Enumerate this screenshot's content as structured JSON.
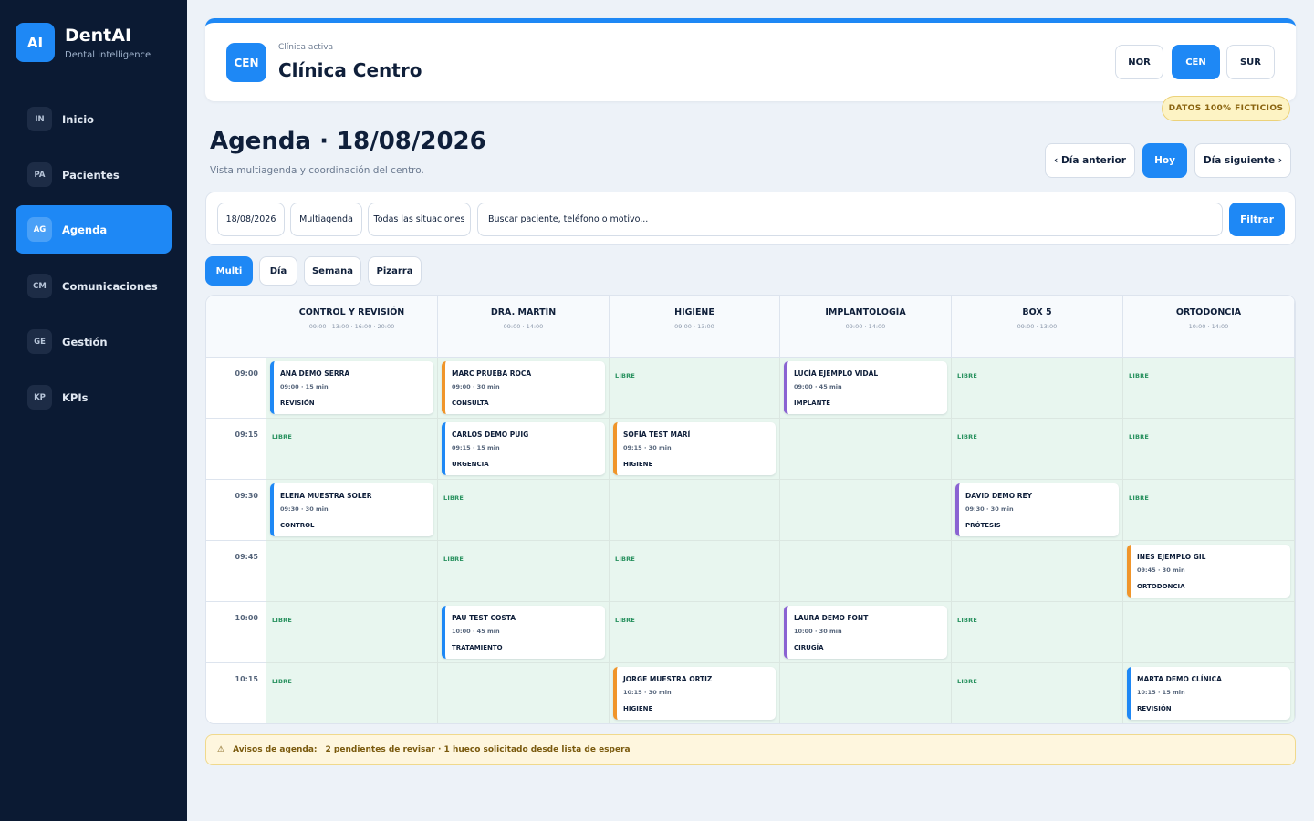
{
  "brand": {
    "logo": "AI",
    "name": "DentAI",
    "tagline": "Dental intelligence"
  },
  "nav": [
    {
      "abbr": "IN",
      "label": "Inicio",
      "active": false
    },
    {
      "abbr": "PA",
      "label": "Pacientes",
      "active": false
    },
    {
      "abbr": "AG",
      "label": "Agenda",
      "active": true
    },
    {
      "abbr": "CM",
      "label": "Comunicaciones",
      "active": false
    },
    {
      "abbr": "GE",
      "label": "Gestión",
      "active": false
    },
    {
      "abbr": "KP",
      "label": "KPIs",
      "active": false
    }
  ],
  "header": {
    "logo": "CEN",
    "label": "Clínica activa",
    "clinic_name": "Clínica Centro",
    "clinic_buttons": [
      {
        "label": "NOR",
        "active": false
      },
      {
        "label": "CEN",
        "active": true
      },
      {
        "label": "SUR",
        "active": false
      }
    ],
    "badge": "DATOS 100% FICTICIOS"
  },
  "page": {
    "title": "Agenda · 18/08/2026",
    "subtitle": "Vista multiagenda y coordinación del centro.",
    "prev_day": "‹ Día anterior",
    "today": "Hoy",
    "next_day": "Día siguiente ›"
  },
  "filters": {
    "date": "18/08/2026",
    "mode": "Multiagenda",
    "status": "Todas las situaciones",
    "search_placeholder": "Buscar paciente, teléfono o motivo...",
    "submit": "Filtrar"
  },
  "views": [
    {
      "label": "Multi",
      "active": true
    },
    {
      "label": "Día",
      "active": false
    },
    {
      "label": "Semana",
      "active": false
    },
    {
      "label": "Pizarra",
      "active": false
    }
  ],
  "colors": {
    "accent": "#1e88f5",
    "sidebar": "#0b1a33",
    "free_slot": "#e8f6ef",
    "blue": "#1e88f5",
    "orange": "#f0952a",
    "purple": "#8a63d2"
  },
  "schedule": {
    "columns": [
      {
        "name": "CONTROL Y REVISIÓN",
        "hours": "09:00 · 13:00 · 16:00 · 20:00"
      },
      {
        "name": "DRA. MARTÍN",
        "hours": "09:00 · 14:00"
      },
      {
        "name": "HIGIENE",
        "hours": "09:00 · 13:00"
      },
      {
        "name": "IMPLANTOLOGÍA",
        "hours": "09:00 · 14:00"
      },
      {
        "name": "BOX 5",
        "hours": "09:00 · 13:00"
      },
      {
        "name": "ORTODONCIA",
        "hours": "10:00 · 14:00"
      }
    ],
    "free_label": "LIBRE",
    "rows": [
      {
        "time": "09:00",
        "cells": [
          {
            "kind": "appt",
            "name": "ANA DEMO SERRA",
            "detail": "09:00 · 15 min",
            "type": "REVISIÓN",
            "color": "blue"
          },
          {
            "kind": "appt",
            "name": "MARC PRUEBA ROCA",
            "detail": "09:00 · 30 min",
            "type": "CONSULTA",
            "color": "orange"
          },
          {
            "kind": "free"
          },
          {
            "kind": "appt",
            "name": "LUCÍA EJEMPLO VIDAL",
            "detail": "09:00 · 45 min",
            "type": "IMPLANTE",
            "color": "purple"
          },
          {
            "kind": "free"
          },
          {
            "kind": "free"
          }
        ]
      },
      {
        "time": "09:15",
        "cells": [
          {
            "kind": "free"
          },
          {
            "kind": "appt",
            "name": "CARLOS DEMO PUIG",
            "detail": "09:15 · 15 min",
            "type": "URGENCIA",
            "color": "blue"
          },
          {
            "kind": "appt",
            "name": "SOFÍA TEST MARÍ",
            "detail": "09:15 · 30 min",
            "type": "HIGIENE",
            "color": "orange"
          },
          {
            "kind": "empty"
          },
          {
            "kind": "free"
          },
          {
            "kind": "free"
          }
        ]
      },
      {
        "time": "09:30",
        "cells": [
          {
            "kind": "appt",
            "name": "ELENA MUESTRA SOLER",
            "detail": "09:30 · 30 min",
            "type": "CONTROL",
            "color": "blue"
          },
          {
            "kind": "free"
          },
          {
            "kind": "empty"
          },
          {
            "kind": "empty"
          },
          {
            "kind": "appt",
            "name": "DAVID DEMO REY",
            "detail": "09:30 · 30 min",
            "type": "PRÓTESIS",
            "color": "purple"
          },
          {
            "kind": "free"
          }
        ]
      },
      {
        "time": "09:45",
        "cells": [
          {
            "kind": "empty"
          },
          {
            "kind": "free"
          },
          {
            "kind": "free"
          },
          {
            "kind": "empty"
          },
          {
            "kind": "empty"
          },
          {
            "kind": "appt",
            "name": "INES EJEMPLO GIL",
            "detail": "09:45 · 30 min",
            "type": "ORTODONCIA",
            "color": "orange"
          }
        ]
      },
      {
        "time": "10:00",
        "cells": [
          {
            "kind": "free"
          },
          {
            "kind": "appt",
            "name": "PAU TEST COSTA",
            "detail": "10:00 · 45 min",
            "type": "TRATAMIENTO",
            "color": "blue"
          },
          {
            "kind": "free"
          },
          {
            "kind": "appt",
            "name": "LAURA DEMO FONT",
            "detail": "10:00 · 30 min",
            "type": "CIRUGÍA",
            "color": "purple"
          },
          {
            "kind": "free"
          },
          {
            "kind": "empty"
          }
        ]
      },
      {
        "time": "10:15",
        "cells": [
          {
            "kind": "free"
          },
          {
            "kind": "empty"
          },
          {
            "kind": "appt",
            "name": "JORGE MUESTRA ORTIZ",
            "detail": "10:15 · 30 min",
            "type": "HIGIENE",
            "color": "orange"
          },
          {
            "kind": "empty"
          },
          {
            "kind": "free"
          },
          {
            "kind": "appt",
            "name": "MARTA DEMO CLÍNICA",
            "detail": "10:15 · 15 min",
            "type": "REVISIÓN",
            "color": "blue"
          }
        ]
      }
    ]
  },
  "notice": {
    "icon": "warning-icon",
    "symbol": "⚠",
    "label": "Avisos de agenda:",
    "message": "2 pendientes de revisar · 1 hueco solicitado desde lista de espera"
  }
}
